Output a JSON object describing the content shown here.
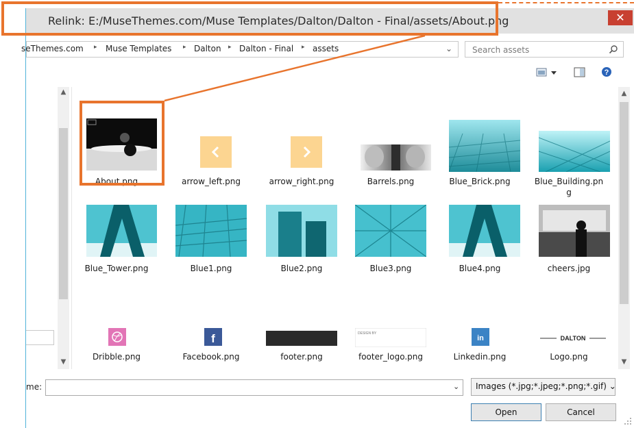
{
  "dialog": {
    "title": "Relink: E:/MuseThemes.com/Muse Templates/Dalton/Dalton - Final/assets/About.png",
    "close_glyph": "✕"
  },
  "address": {
    "crumbs": [
      "seThemes.com",
      "Muse Templates",
      "Dalton",
      "Dalton - Final",
      "assets"
    ],
    "separator": "▸",
    "dropdown_glyph": "⌄",
    "refresh_glyph": "↻"
  },
  "search": {
    "placeholder": "Search assets"
  },
  "files": [
    {
      "name": "About.png",
      "caption_lines": [
        "About.png"
      ],
      "thumb": "about-photo"
    },
    {
      "name": "arrow_left.png",
      "caption_lines": [
        "arrow_left.png"
      ],
      "thumb": "arrow-left",
      "glyph": "‹"
    },
    {
      "name": "arrow_right.png",
      "caption_lines": [
        "arrow_right.png"
      ],
      "thumb": "arrow-right",
      "glyph": "›"
    },
    {
      "name": "Barrels.png",
      "caption_lines": [
        "Barrels.png"
      ],
      "thumb": "barrels-photo"
    },
    {
      "name": "Blue_Brick.png",
      "caption_lines": [
        "Blue_Brick.png"
      ],
      "thumb": "blue-photo"
    },
    {
      "name": "Blue_Building.png",
      "caption_lines": [
        "Blue_Building.pn",
        "g"
      ],
      "thumb": "blue-photo"
    },
    {
      "name": "Blue_Tower.png",
      "caption_lines": [
        "Blue_Tower.png"
      ],
      "thumb": "tower-photo"
    },
    {
      "name": "Blue1.png",
      "caption_lines": [
        "Blue1.png"
      ],
      "thumb": "blue-photo"
    },
    {
      "name": "Blue2.png",
      "caption_lines": [
        "Blue2.png"
      ],
      "thumb": "blue-photo"
    },
    {
      "name": "Blue3.png",
      "caption_lines": [
        "Blue3.png"
      ],
      "thumb": "blue-photo"
    },
    {
      "name": "Blue4.png",
      "caption_lines": [
        "Blue4.png"
      ],
      "thumb": "tower-photo"
    },
    {
      "name": "cheers.jpg",
      "caption_lines": [
        "cheers.jpg"
      ],
      "thumb": "cheers-photo"
    },
    {
      "name": "Dribble.png",
      "caption_lines": [
        "Dribble.png"
      ],
      "thumb": "dribbble-icon",
      "glyph": "◎"
    },
    {
      "name": "Facebook.png",
      "caption_lines": [
        "Facebook.png"
      ],
      "thumb": "facebook-icon",
      "glyph": "f"
    },
    {
      "name": "footer.png",
      "caption_lines": [
        "footer.png"
      ],
      "thumb": "footer-bar"
    },
    {
      "name": "footer_logo.png",
      "caption_lines": [
        "footer_logo.png"
      ],
      "thumb": "footer-logo",
      "glyph": "DESIGN BY"
    },
    {
      "name": "Linkedin.png",
      "caption_lines": [
        "Linkedin.png"
      ],
      "thumb": "linkedin-icon",
      "glyph": "in"
    },
    {
      "name": "Logo.png",
      "caption_lines": [
        "Logo.png"
      ],
      "thumb": "logo-wordmark",
      "glyph": "DALTON"
    }
  ],
  "footer": {
    "filename_label": "me:",
    "filename_value": "",
    "filename_drop": "⌄",
    "filter": "Images (*.jpg;*.jpeg;*.png;*.gif)",
    "filter_glyph": "⌄",
    "open_label": "Open",
    "cancel_label": "Cancel"
  },
  "colors": {
    "highlight": "#e8742d",
    "teal": "#3fb6c4",
    "close": "#c84031"
  }
}
